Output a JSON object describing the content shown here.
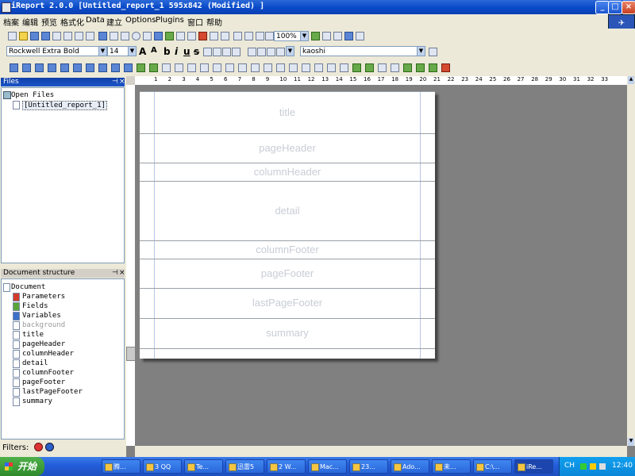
{
  "window": {
    "title": "iReport 2.0.0  [Untitled_report_1 595x842 (Modified) ]",
    "minimize": "_",
    "maximize": "□",
    "close": "×"
  },
  "menu": [
    "档案",
    "编辑",
    "预览",
    "格式化",
    "Data",
    "建立",
    "Options",
    "Plugins",
    "窗口",
    "帮助"
  ],
  "toolbar": {
    "zoom": "100%",
    "font_name": "Rockwell Extra Bold",
    "font_size": "14",
    "style_buttons": [
      "b",
      "i",
      "u",
      "s"
    ],
    "expression_field": "kaoshi"
  },
  "files_panel": {
    "title": "Files",
    "controls": [
      "⊣",
      "×"
    ],
    "root": "Open Files",
    "items": [
      "[Untitled_report_1]"
    ]
  },
  "structure_panel": {
    "title": "Document structure",
    "controls": [
      "⊣",
      "×"
    ],
    "root": "Document",
    "items": [
      {
        "label": "Parameters",
        "icon": "red"
      },
      {
        "label": "Fields",
        "icon": "green"
      },
      {
        "label": "Variables",
        "icon": "blue"
      },
      {
        "label": "background",
        "icon": "none",
        "dim": true
      },
      {
        "label": "title",
        "icon": "none"
      },
      {
        "label": "pageHeader",
        "icon": "none"
      },
      {
        "label": "columnHeader",
        "icon": "none"
      },
      {
        "label": "detail",
        "icon": "none"
      },
      {
        "label": "columnFooter",
        "icon": "none"
      },
      {
        "label": "pageFooter",
        "icon": "none"
      },
      {
        "label": "lastPageFooter",
        "icon": "none"
      },
      {
        "label": "summary",
        "icon": "none"
      }
    ]
  },
  "filters_label": "Filters:",
  "ruler_numbers": [
    "1",
    "2",
    "3",
    "4",
    "5",
    "6",
    "7",
    "8",
    "9",
    "10",
    "11",
    "12",
    "13",
    "14",
    "15",
    "16",
    "17",
    "18",
    "19",
    "20",
    "21",
    "22",
    "23",
    "24",
    "25",
    "26",
    "27",
    "28",
    "29",
    "30",
    "31",
    "32",
    "33"
  ],
  "report_bands": [
    "title",
    "pageHeader",
    "columnHeader",
    "detail",
    "columnFooter",
    "pageFooter",
    "lastPageFooter",
    "summary"
  ],
  "taskbar": {
    "start": "开始",
    "tasks": [
      "腾...",
      "3 QQ",
      "Te...",
      "迅雷5",
      "2 W...",
      "Mac...",
      "23...",
      "Ado...",
      "未...",
      "C:\\...",
      "iRe..."
    ],
    "clock": "12:40",
    "lang": "CH"
  }
}
